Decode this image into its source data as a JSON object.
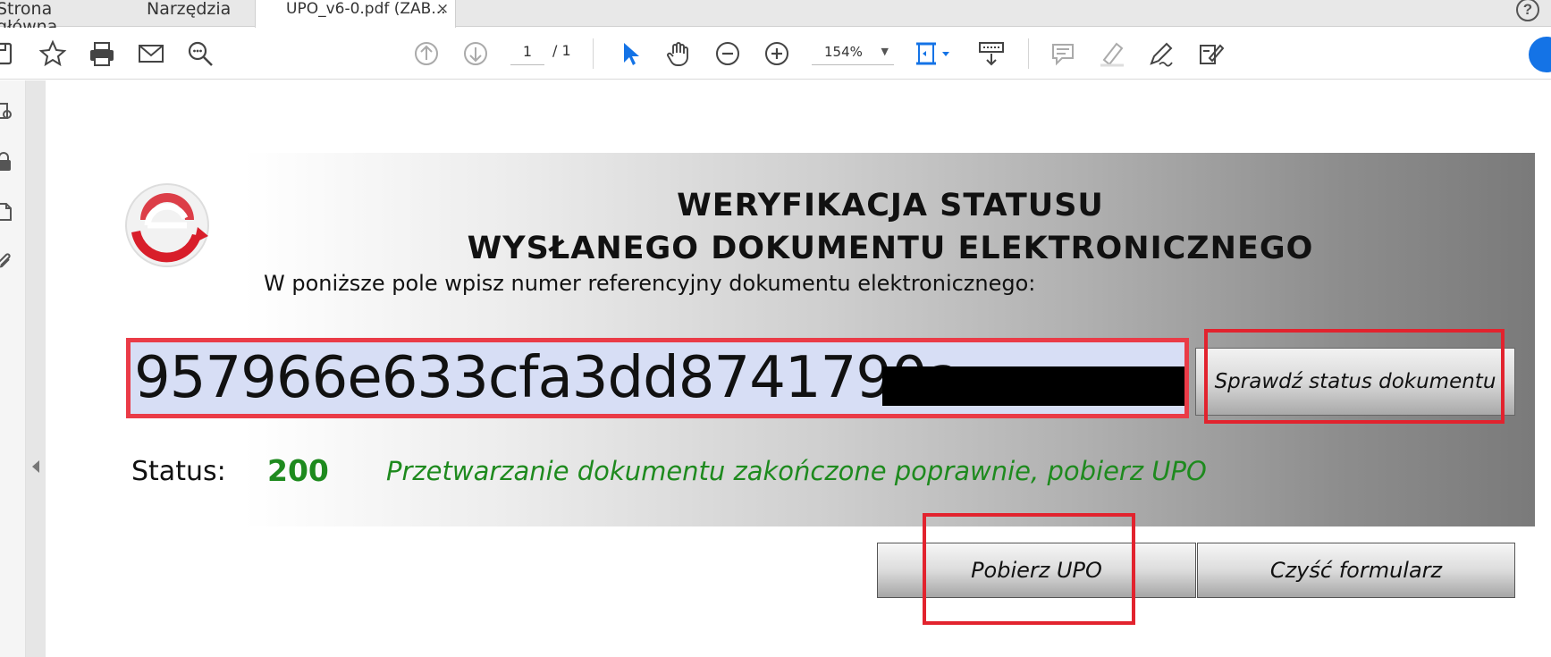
{
  "tabs": {
    "home": "Strona główna",
    "tools": "Narzędzia",
    "document": "UPO_v6-0.pdf (ZAB...",
    "close_glyph": "×"
  },
  "help_glyph": "?",
  "toolbar": {
    "page_current": "1",
    "page_total": "/ 1",
    "zoom": "154%",
    "zoom_caret": "▼"
  },
  "form": {
    "title_line1": "WERYFIKACJA  STATUSU",
    "title_line2": "WYSŁANEGO  DOKUMENTU  ELEKTRONICZNEGO",
    "instruction": "W poniższe pole wpisz numer referencyjny dokumentu elektronicznego:",
    "reference_value": "957966e633cfa3dd8741790a",
    "check_button": "Sprawdź status dokumentu",
    "status_label": "Status:",
    "status_code": "200",
    "status_message": "Przetwarzanie dokumentu zakończone poprawnie, pobierz UPO",
    "download_button": "Pobierz UPO",
    "clear_button": "Czyść formularz"
  },
  "colors": {
    "highlight_red": "#e2232e",
    "status_green": "#1e8a1e",
    "input_bg": "#d7def5",
    "accent_blue": "#1473e6"
  },
  "icons": {
    "toolbar": [
      "save-icon",
      "star-icon",
      "print-icon",
      "mail-icon",
      "search-zoom-icon",
      "prev-page-icon",
      "next-page-icon",
      "select-cursor-icon",
      "hand-icon",
      "zoom-out-icon",
      "zoom-in-icon",
      "fit-page-icon",
      "scroll-mode-icon",
      "comment-icon",
      "highlight-icon",
      "sign-icon",
      "fill-sign-icon"
    ],
    "left_rail": [
      "page-search-icon",
      "lock-icon",
      "pages-icon",
      "attachment-icon"
    ],
    "logo": "e-deklaracje-logo"
  }
}
